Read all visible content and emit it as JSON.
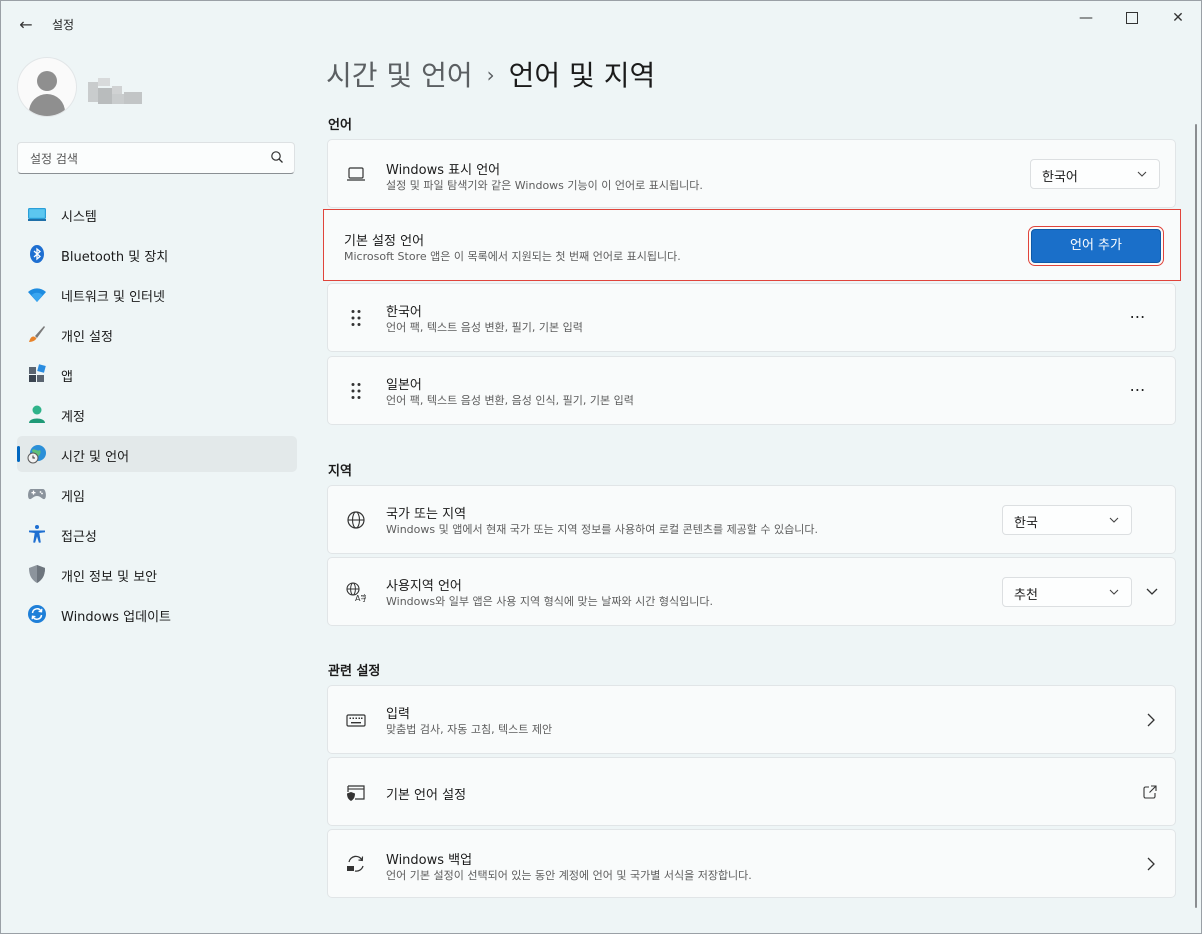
{
  "window": {
    "title": "설정",
    "back_glyph": "←",
    "minimize_glyph": "—",
    "close_glyph": "✕"
  },
  "search": {
    "placeholder": "설정 검색",
    "icon": "search-icon"
  },
  "sidebar": {
    "items": [
      {
        "label": "시스템",
        "icon": "system-monitor-icon",
        "active": false
      },
      {
        "label": "Bluetooth 및 장치",
        "icon": "bluetooth-icon",
        "active": false
      },
      {
        "label": "네트워크 및 인터넷",
        "icon": "wifi-icon",
        "active": false
      },
      {
        "label": "개인 설정",
        "icon": "paintbrush-icon",
        "active": false
      },
      {
        "label": "앱",
        "icon": "apps-icon",
        "active": false
      },
      {
        "label": "계정",
        "icon": "account-icon",
        "active": false
      },
      {
        "label": "시간 및 언어",
        "icon": "globe-clock-icon",
        "active": true
      },
      {
        "label": "게임",
        "icon": "gamepad-icon",
        "active": false
      },
      {
        "label": "접근성",
        "icon": "accessibility-icon",
        "active": false
      },
      {
        "label": "개인 정보 및 보안",
        "icon": "shield-icon",
        "active": false
      },
      {
        "label": "Windows 업데이트",
        "icon": "update-icon",
        "active": false
      }
    ]
  },
  "breadcrumb": {
    "parent": "시간 및 언어",
    "separator": "›",
    "current": "언어 및 지역"
  },
  "language_section": {
    "title": "언어",
    "display_language": {
      "title": "Windows 표시 언어",
      "description": "설정 및 파일 탐색기와 같은 Windows 기능이 이 언어로 표시됩니다.",
      "value": "한국어"
    },
    "preferred_languages": {
      "title": "기본 설정 언어",
      "description": "Microsoft Store 앱은 이 목록에서 지원되는 첫 번째 언어로 표시됩니다.",
      "button_label": "언어 추가"
    },
    "languages": [
      {
        "name": "한국어",
        "features": "언어 팩, 텍스트 음성 변환, 필기, 기본 입력"
      },
      {
        "name": "일본어",
        "features": "언어 팩, 텍스트 음성 변환, 음성 인식, 필기, 기본 입력"
      }
    ],
    "more_glyph": "⋯"
  },
  "region_section": {
    "title": "지역",
    "country": {
      "title": "국가 또는 지역",
      "description": "Windows 및 앱에서 현재 국가 또는 지역 정보를 사용하여 로컬 콘텐츠를 제공할 수 있습니다.",
      "value": "한국"
    },
    "regional_format": {
      "title": "사용지역 언어",
      "description": "Windows와 일부 앱은 사용 지역 형식에 맞는 날짜와 시간 형식입니다.",
      "value": "추천"
    }
  },
  "related_section": {
    "title": "관련 설정",
    "typing": {
      "title": "입력",
      "description": "맞춤법 검사, 자동 고침, 텍스트 제안"
    },
    "admin_language": {
      "title": "기본 언어 설정"
    },
    "windows_backup": {
      "title": "Windows 백업",
      "description": "언어 기본 설정이 선택되어 있는 동안 계정에 언어 및 국가별 서식을 저장합니다."
    }
  },
  "colors": {
    "accent": "#1a6fc9",
    "highlight_border": "#e0443b",
    "background": "#eef5f6"
  }
}
